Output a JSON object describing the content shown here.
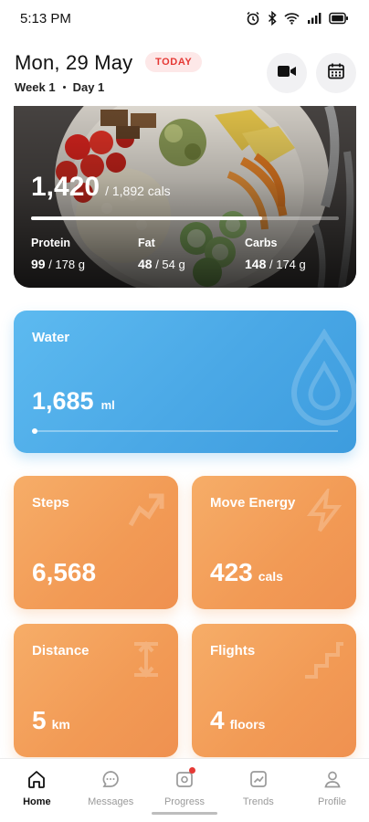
{
  "status_bar": {
    "time": "5:13 PM",
    "icons": [
      "alarm-icon",
      "bluetooth-icon",
      "wifi-icon",
      "signal-icon",
      "battery-icon"
    ]
  },
  "header": {
    "date": "Mon, 29 May",
    "today_badge": "TODAY",
    "week": "Week 1",
    "day": "Day 1"
  },
  "nutrition": {
    "calories": "1,420",
    "calories_target": "/ 1,892 cals",
    "calories_progress": 0.75,
    "macros": [
      {
        "label": "Protein",
        "value": "99",
        "target": "/ 178 g"
      },
      {
        "label": "Fat",
        "value": "48",
        "target": "/ 54 g"
      },
      {
        "label": "Carbs",
        "value": "148",
        "target": "/ 174 g"
      }
    ]
  },
  "water": {
    "title": "Water",
    "value": "1,685",
    "unit": "ml"
  },
  "tiles": [
    {
      "title": "Steps",
      "value": "6,568",
      "unit": ""
    },
    {
      "title": "Move Energy",
      "value": "423",
      "unit": "cals"
    },
    {
      "title": "Distance",
      "value": "5",
      "unit": "km"
    },
    {
      "title": "Flights",
      "value": "4",
      "unit": "floors"
    }
  ],
  "nav": {
    "items": [
      {
        "label": "Home",
        "icon": "home-icon"
      },
      {
        "label": "Messages",
        "icon": "messages-icon"
      },
      {
        "label": "Progress",
        "icon": "progress-icon"
      },
      {
        "label": "Trends",
        "icon": "trends-icon"
      },
      {
        "label": "Profile",
        "icon": "profile-icon"
      }
    ]
  },
  "colors": {
    "water": "#4aa8e6",
    "activity": "#f29a55",
    "today": "#e53935"
  }
}
